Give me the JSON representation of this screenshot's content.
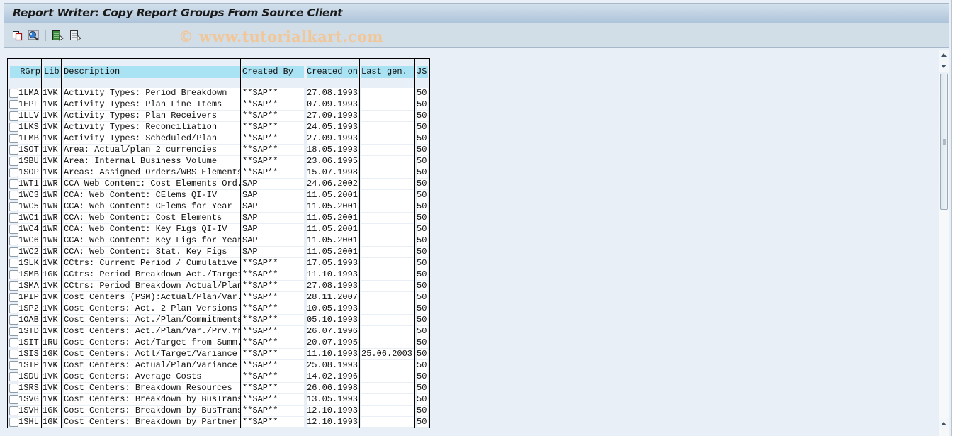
{
  "window": {
    "title": "Report Writer: Copy Report Groups From Source Client"
  },
  "toolbar": {
    "buttons": [
      {
        "icon": "copy-icon",
        "label": "Copy"
      },
      {
        "icon": "find-icon",
        "label": "Find"
      },
      {
        "icon": "select-all-icon",
        "label": "Select All"
      },
      {
        "icon": "deselect-all-icon",
        "label": "Deselect All"
      }
    ],
    "watermark": "© www.tutorialkart.com"
  },
  "table": {
    "columns": [
      "RGrp",
      "Lib",
      "Description",
      "Created By",
      "Created on",
      "Last gen.",
      "JS"
    ],
    "rows": [
      {
        "rgrp": "1LMA",
        "lib": "1VK",
        "desc": "Activity Types: Period Breakdown",
        "by": "**SAP**",
        "on": "27.08.1993",
        "gen": "",
        "js": "50"
      },
      {
        "rgrp": "1EPL",
        "lib": "1VK",
        "desc": "Activity Types: Plan Line Items",
        "by": "**SAP**",
        "on": "07.09.1993",
        "gen": "",
        "js": "50"
      },
      {
        "rgrp": "1LLV",
        "lib": "1VK",
        "desc": "Activity Types: Plan Receivers",
        "by": "**SAP**",
        "on": "27.09.1993",
        "gen": "",
        "js": "50"
      },
      {
        "rgrp": "1LKS",
        "lib": "1VK",
        "desc": "Activity Types: Reconciliation",
        "by": "**SAP**",
        "on": "24.05.1993",
        "gen": "",
        "js": "50"
      },
      {
        "rgrp": "1LMB",
        "lib": "1VK",
        "desc": "Activity Types: Scheduled/Plan",
        "by": "**SAP**",
        "on": "27.09.1993",
        "gen": "",
        "js": "50"
      },
      {
        "rgrp": "1SOT",
        "lib": "1VK",
        "desc": "Area: Actual/plan 2 currencies",
        "by": "**SAP**",
        "on": "18.05.1993",
        "gen": "",
        "js": "50"
      },
      {
        "rgrp": "1SBU",
        "lib": "1VK",
        "desc": "Area: Internal Business Volume",
        "by": "**SAP**",
        "on": "23.06.1995",
        "gen": "",
        "js": "50"
      },
      {
        "rgrp": "1SOP",
        "lib": "1VK",
        "desc": "Areas: Assigned Orders/WBS Elements",
        "by": "**SAP**",
        "on": "15.07.1998",
        "gen": "",
        "js": "50"
      },
      {
        "rgrp": "1WT1",
        "lib": "1WR",
        "desc": "CCA Web Content: Cost Elements Ord.",
        "by": "SAP",
        "on": "24.06.2002",
        "gen": "",
        "js": "50"
      },
      {
        "rgrp": "1WC3",
        "lib": "1WR",
        "desc": "CCA: Web Content: CElems QI-IV",
        "by": "SAP",
        "on": "11.05.2001",
        "gen": "",
        "js": "50"
      },
      {
        "rgrp": "1WC5",
        "lib": "1WR",
        "desc": "CCA: Web Content: CElems for Year",
        "by": "SAP",
        "on": "11.05.2001",
        "gen": "",
        "js": "50"
      },
      {
        "rgrp": "1WC1",
        "lib": "1WR",
        "desc": "CCA: Web Content: Cost Elements",
        "by": "SAP",
        "on": "11.05.2001",
        "gen": "",
        "js": "50"
      },
      {
        "rgrp": "1WC4",
        "lib": "1WR",
        "desc": "CCA: Web Content: Key Figs QI-IV",
        "by": "SAP",
        "on": "11.05.2001",
        "gen": "",
        "js": "50"
      },
      {
        "rgrp": "1WC6",
        "lib": "1WR",
        "desc": "CCA: Web Content: Key Figs for Year",
        "by": "SAP",
        "on": "11.05.2001",
        "gen": "",
        "js": "50"
      },
      {
        "rgrp": "1WC2",
        "lib": "1WR",
        "desc": "CCA: Web Content: Stat. Key Figs",
        "by": "SAP",
        "on": "11.05.2001",
        "gen": "",
        "js": "50"
      },
      {
        "rgrp": "1SLK",
        "lib": "1VK",
        "desc": "CCtrs: Current Period / Cumulative",
        "by": "**SAP**",
        "on": "17.05.1993",
        "gen": "",
        "js": "50"
      },
      {
        "rgrp": "1SMB",
        "lib": "1GK",
        "desc": "CCtrs: Period Breakdown Act./Target",
        "by": "**SAP**",
        "on": "11.10.1993",
        "gen": "",
        "js": "50"
      },
      {
        "rgrp": "1SMA",
        "lib": "1VK",
        "desc": "CCtrs: Period Breakdown Actual/Plan",
        "by": "**SAP**",
        "on": "27.08.1993",
        "gen": "",
        "js": "50"
      },
      {
        "rgrp": "1PIP",
        "lib": "1VK",
        "desc": "Cost Centers (PSM):Actual/Plan/Var.",
        "by": "**SAP**",
        "on": "28.11.2007",
        "gen": "",
        "js": "50"
      },
      {
        "rgrp": "1SP2",
        "lib": "1VK",
        "desc": "Cost Centers: Act. 2 Plan Versions",
        "by": "**SAP**",
        "on": "10.05.1993",
        "gen": "",
        "js": "50"
      },
      {
        "rgrp": "1OAB",
        "lib": "1VK",
        "desc": "Cost Centers: Act./Plan/Commitments",
        "by": "**SAP**",
        "on": "05.10.1993",
        "gen": "",
        "js": "50"
      },
      {
        "rgrp": "1STD",
        "lib": "1VK",
        "desc": "Cost Centers: Act./Plan/Var./Prv.Yr",
        "by": "**SAP**",
        "on": "26.07.1996",
        "gen": "",
        "js": "50"
      },
      {
        "rgrp": "1SIT",
        "lib": "1RU",
        "desc": "Cost Centers: Act/Target from Summ.",
        "by": "**SAP**",
        "on": "20.07.1995",
        "gen": "",
        "js": "50"
      },
      {
        "rgrp": "1SIS",
        "lib": "1GK",
        "desc": "Cost Centers: Actl/Target/Variance",
        "by": "**SAP**",
        "on": "11.10.1993",
        "gen": "25.06.2003",
        "js": "50"
      },
      {
        "rgrp": "1SIP",
        "lib": "1VK",
        "desc": "Cost Centers: Actual/Plan/Variance",
        "by": "**SAP**",
        "on": "25.08.1993",
        "gen": "",
        "js": "50"
      },
      {
        "rgrp": "1SDU",
        "lib": "1VK",
        "desc": "Cost Centers: Average Costs",
        "by": "**SAP**",
        "on": "14.02.1996",
        "gen": "",
        "js": "50"
      },
      {
        "rgrp": "1SRS",
        "lib": "1VK",
        "desc": "Cost Centers: Breakdown Resources",
        "by": "**SAP**",
        "on": "26.06.1998",
        "gen": "",
        "js": "50"
      },
      {
        "rgrp": "1SVG",
        "lib": "1VK",
        "desc": "Cost Centers: Breakdown by BusTrans",
        "by": "**SAP**",
        "on": "13.05.1993",
        "gen": "",
        "js": "50"
      },
      {
        "rgrp": "1SVH",
        "lib": "1GK",
        "desc": "Cost Centers: Breakdown by BusTrans",
        "by": "**SAP**",
        "on": "12.10.1993",
        "gen": "",
        "js": "50"
      },
      {
        "rgrp": "1SHL",
        "lib": "1GK",
        "desc": "Cost Centers: Breakdown by Partner",
        "by": "**SAP**",
        "on": "12.10.1993",
        "gen": "",
        "js": "50"
      }
    ]
  }
}
